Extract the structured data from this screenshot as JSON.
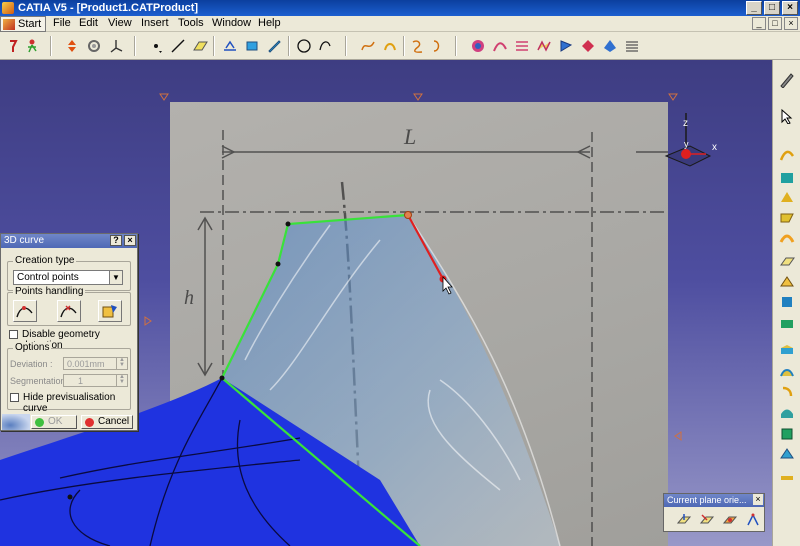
{
  "window": {
    "title": "CATIA V5 - [Product1.CATProduct]",
    "minimize": "_",
    "maximize": "□",
    "close": "×"
  },
  "menubar": {
    "start": "Start",
    "items": [
      "File",
      "Edit",
      "View",
      "Insert",
      "Tools",
      "Window",
      "Help"
    ],
    "mdi": [
      "_",
      "□",
      "×"
    ]
  },
  "toolbar": {
    "icons": [
      "help-icon",
      "select-run-icon",
      "pan-icon",
      "rotate-icon",
      "axis-icon",
      "point-icon",
      "line-icon",
      "plane-icon",
      "sketch-3d-icon",
      "import-icon",
      "draw-icon",
      "circle-icon",
      "curve-icon",
      "spline-icon",
      "offset-icon",
      "isoparametric-icon",
      "blend-icon",
      "surface-icon",
      "fill-icon",
      "net-surface-icon",
      "styled-icon",
      "sweep-icon",
      "matching-icon",
      "analysis-icon",
      "cut-icon"
    ]
  },
  "viewport": {
    "compass": {
      "z": "z",
      "x": "x",
      "y": "y"
    },
    "sketch_dimension_label": "L",
    "sketch_height_label": "h"
  },
  "dialog": {
    "title": "3D curve",
    "help_btn": "?",
    "close_btn": "×",
    "creation_type_label": "Creation type",
    "creation_type_value": "Control points",
    "points_handling_label": "Points handling",
    "disable_geometry_label": "Disable geometry detection",
    "disable_geometry_checked": false,
    "options_label": "Options",
    "deviation_label": "Deviation :",
    "deviation_value": "0.001mm",
    "segmentation_label": "Segmentation :",
    "segmentation_value": "1",
    "hide_previs_label": "Hide previsualisation curve",
    "hide_previs_checked": false,
    "ok_label": "OK",
    "cancel_label": "Cancel"
  },
  "plane_toolbar": {
    "title": "Current plane orie...",
    "close": "×",
    "icons": [
      "plane-orient-1-icon",
      "plane-orient-2-icon",
      "plane-orient-3-icon",
      "plane-orient-4-icon"
    ]
  },
  "right_toolbar": {
    "icons": [
      "sketch-icon",
      "select-icon",
      "curve-3d-icon",
      "surface-a-icon",
      "surface-b-icon",
      "surface-c-icon",
      "surface-d-icon",
      "plane-surf-icon",
      "extrude-icon",
      "revolve-icon",
      "fillet-icon",
      "blend-surf-icon",
      "cut-surf-icon",
      "trim-icon",
      "fill-surf-icon",
      "match-icon",
      "approx-icon",
      "extend-icon",
      "break-icon",
      "untrim-icon",
      "tools-icon"
    ]
  },
  "colors": {
    "curve_green": "#39e23a",
    "curve_red": "#e02020",
    "surface_blue": "#1f33e0",
    "viewport_top": "#3e3d82",
    "dialog_bg": "#ece9d8"
  }
}
